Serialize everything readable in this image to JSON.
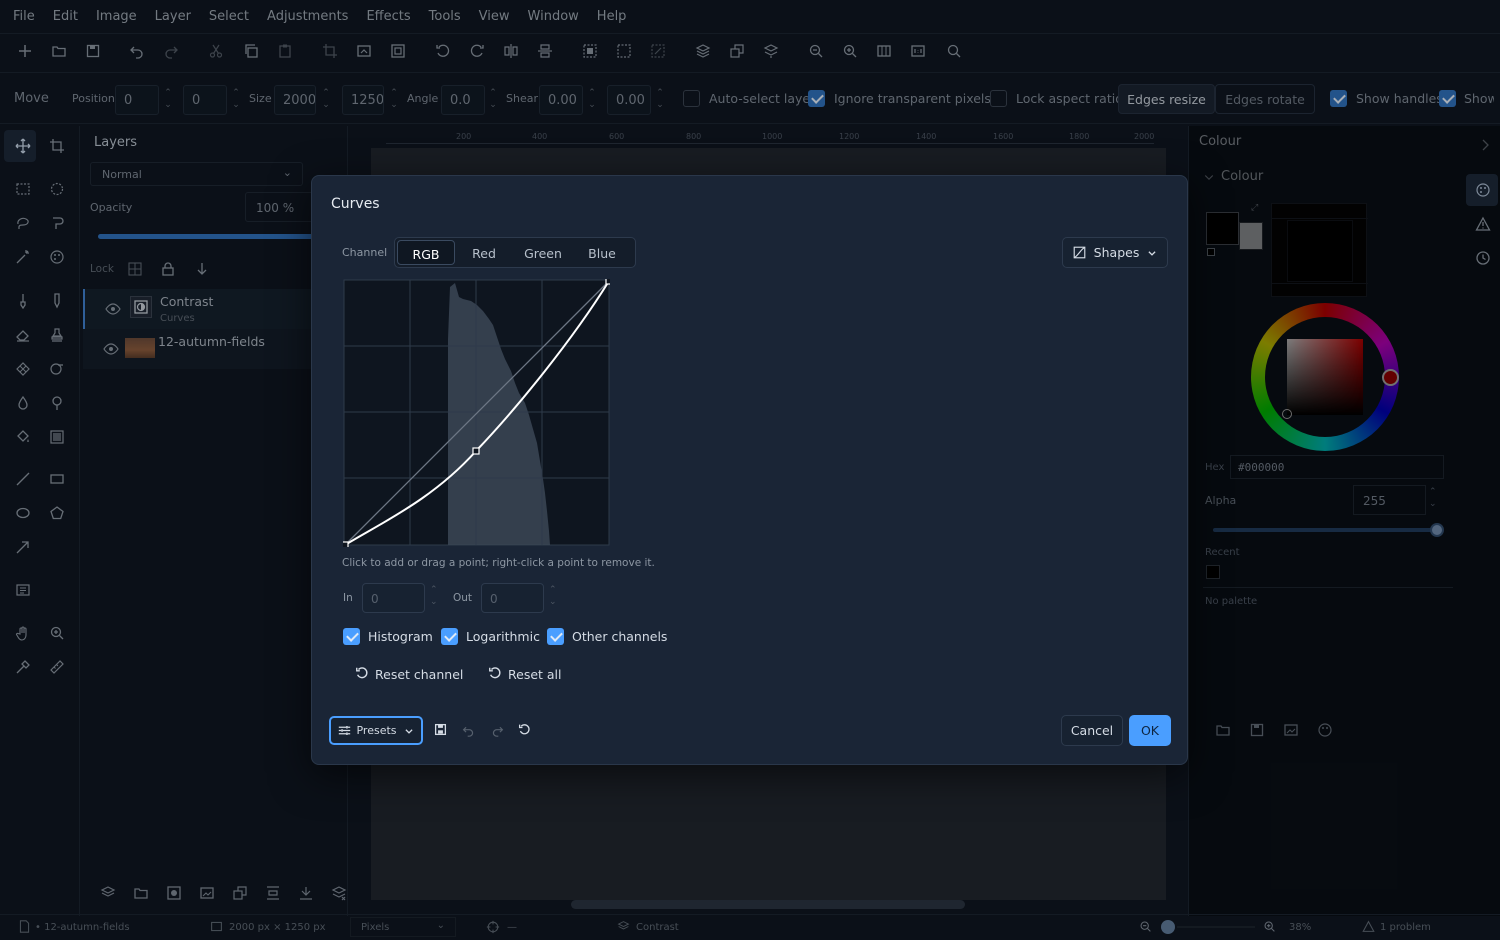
{
  "menu": [
    "File",
    "Edit",
    "Image",
    "Layer",
    "Select",
    "Adjustments",
    "Effects",
    "Tools",
    "View",
    "Window",
    "Help"
  ],
  "options": {
    "tool_name": "Move",
    "position_label": "Position",
    "pos_x": "0",
    "pos_y": "0",
    "size_label": "Size",
    "size_w": "2000",
    "size_h": "1250",
    "angle_label": "Angle",
    "angle": "0.0",
    "shear_label": "Shear",
    "shear_x": "0.00",
    "shear_y": "0.00",
    "auto_select": "Auto-select layer",
    "ignore_transparent": "Ignore transparent pixels",
    "lock_aspect": "Lock aspect ratio",
    "edges_resize": "Edges resize",
    "edges_rotate": "Edges rotate",
    "show_handles": "Show handles",
    "show_more": "Show"
  },
  "layers": {
    "title": "Layers",
    "blend_mode": "Normal",
    "opacity_label": "Opacity",
    "opacity_value": "100 %",
    "opacity_fraction": 1.0,
    "lock_label": "Lock",
    "items": [
      {
        "name": "Contrast",
        "sub": "Curves"
      },
      {
        "name": "12-autumn-fields",
        "sub": ""
      }
    ]
  },
  "ruler": [
    "200",
    "400",
    "600",
    "800",
    "1000",
    "1200",
    "1400",
    "1600",
    "1800",
    "2000"
  ],
  "colour_panel": {
    "title": "Colour",
    "section": "Colour",
    "hex_label": "Hex",
    "hex_value": "#000000",
    "alpha_label": "Alpha",
    "alpha_value": "255",
    "recent_label": "Recent",
    "palette_label": "No palette"
  },
  "dialog": {
    "title": "Curves",
    "channel_label": "Channel",
    "channels": [
      "RGB",
      "Red",
      "Green",
      "Blue"
    ],
    "active_channel": "RGB",
    "shapes_label": "Shapes",
    "hint": "Click to add or drag a point; right-click a point to remove it.",
    "in_label": "In",
    "in_value": "0",
    "out_label": "Out",
    "out_value": "0",
    "histogram_label": "Histogram",
    "logarithmic_label": "Logarithmic",
    "other_channels_label": "Other channels",
    "reset_channel_label": "Reset channel",
    "reset_all_label": "Reset all",
    "presets_label": "Presets",
    "cancel_label": "Cancel",
    "ok_label": "OK"
  },
  "status": {
    "file": "• 12-autumn-fields",
    "dims": "2000 px × 1250 px",
    "units": "Pixels",
    "cursor": "—",
    "layer": "Contrast",
    "zoom": "38%",
    "problems": "1 problem"
  },
  "colors": {
    "accent": "#4a9eff",
    "bg": "#0f1620",
    "dialog": "#1a2536"
  }
}
